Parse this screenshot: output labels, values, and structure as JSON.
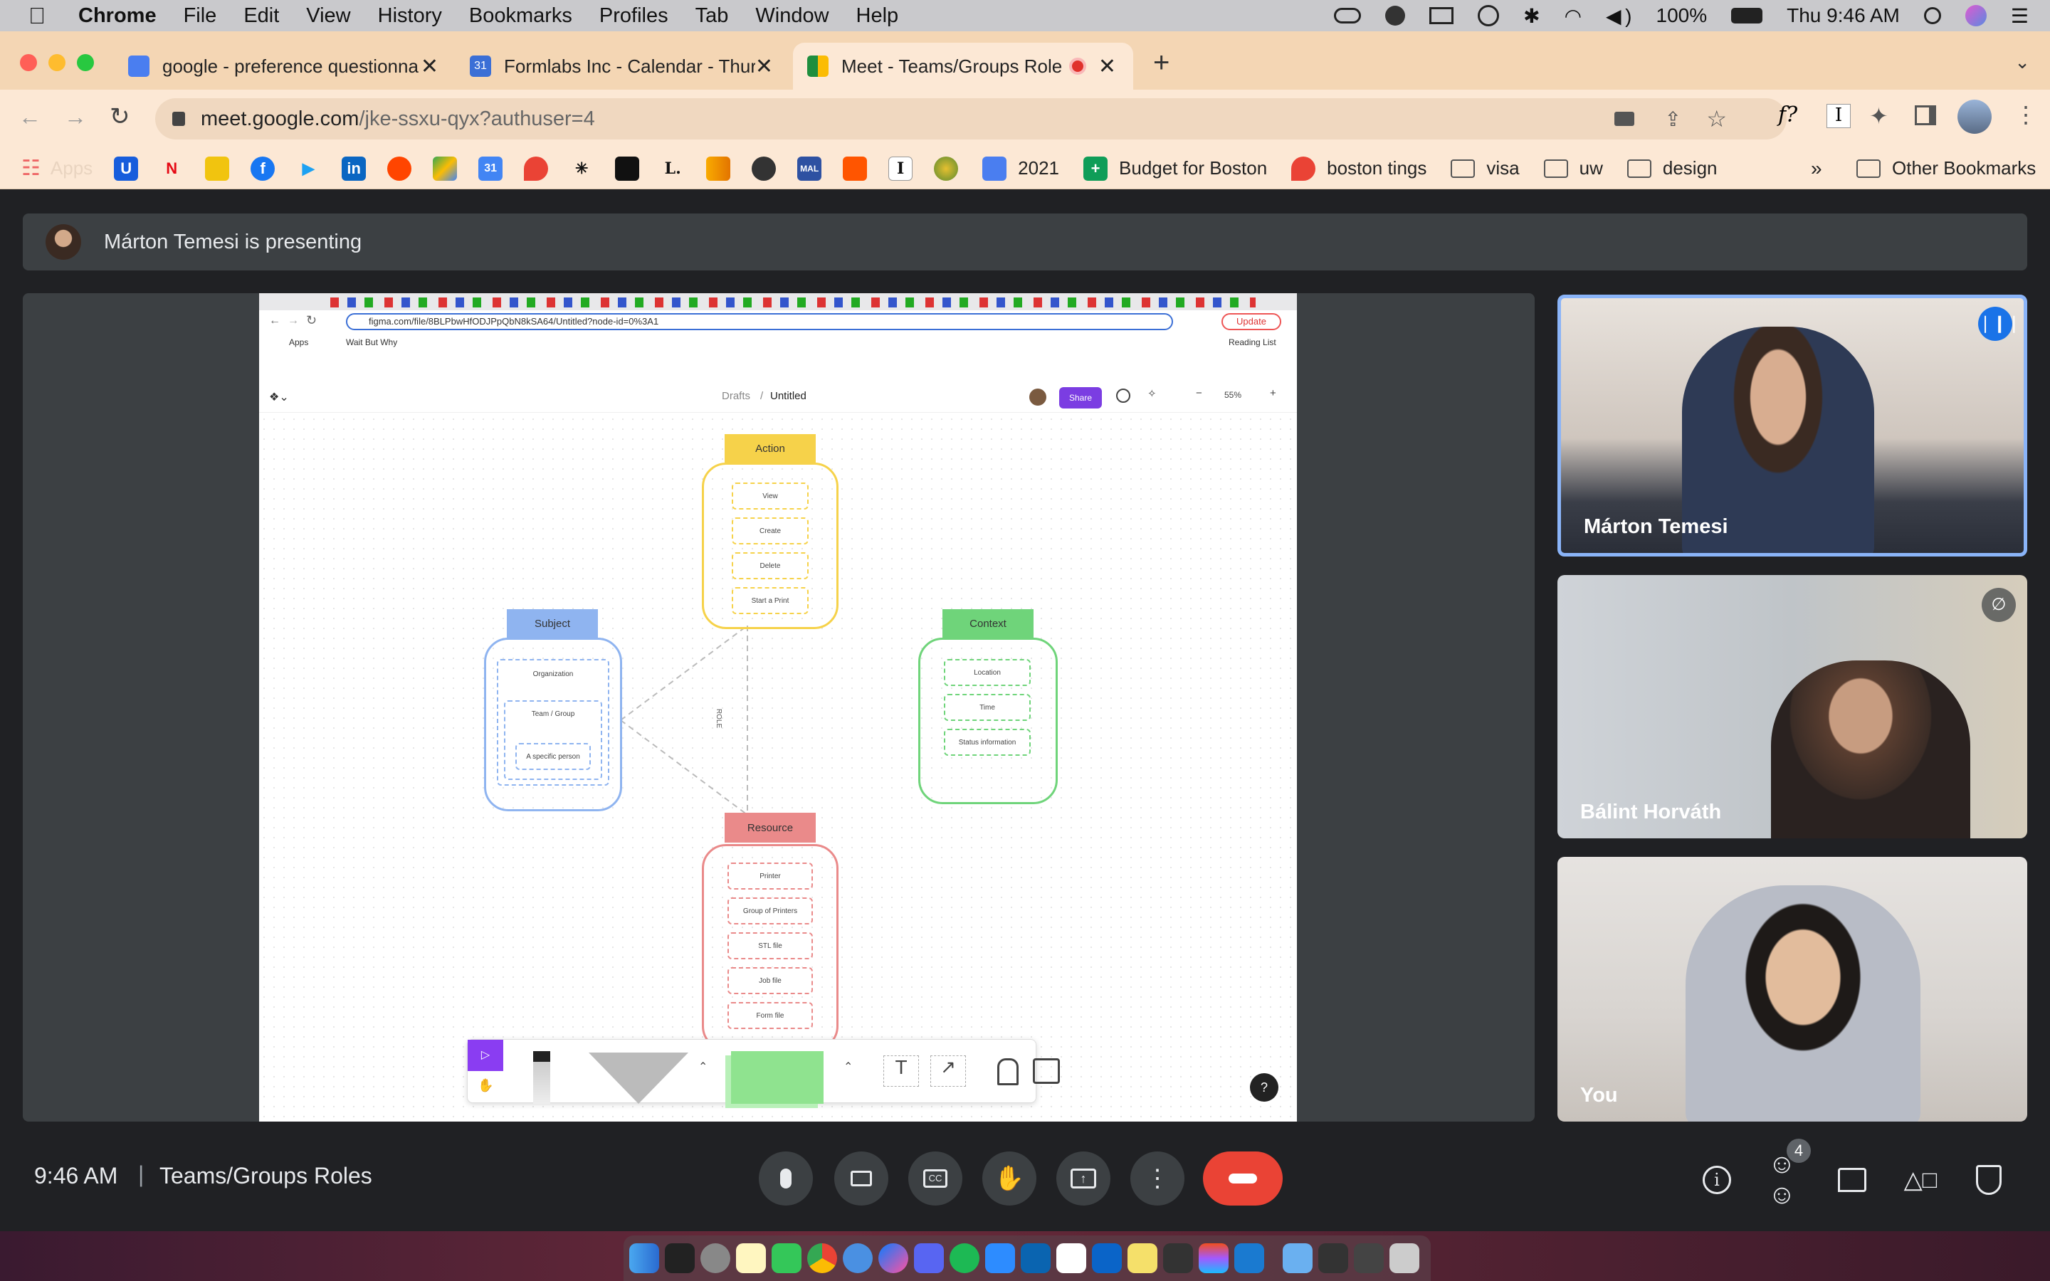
{
  "menubar": {
    "app": "Chrome",
    "items": [
      "File",
      "Edit",
      "View",
      "History",
      "Bookmarks",
      "Profiles",
      "Tab",
      "Window",
      "Help"
    ],
    "battery": "100%",
    "clock": "Thu 9:46 AM"
  },
  "tabs": [
    {
      "title": "google - preference questionna",
      "favicon_color": "#4a7ef0"
    },
    {
      "title": "Formlabs Inc - Calendar - Thur",
      "favicon_color": "#3b6fd6"
    },
    {
      "title": "Meet - Teams/Groups Role",
      "favicon_color": "#1e8e3e"
    }
  ],
  "address": {
    "host": "meet.google.com",
    "path": "/jke-ssxu-qyx?authuser=4"
  },
  "bookmarks": {
    "apps_label": "Apps",
    "named": [
      {
        "label": "2021",
        "kind": "doc"
      },
      {
        "label": "Budget for Boston",
        "kind": "sheet"
      },
      {
        "label": "boston tings",
        "kind": "map"
      },
      {
        "label": "visa",
        "kind": "folder"
      },
      {
        "label": "uw",
        "kind": "folder"
      },
      {
        "label": "design",
        "kind": "folder"
      }
    ],
    "more": "»",
    "other": "Other Bookmarks"
  },
  "presenting": {
    "text": "Márton Temesi is presenting"
  },
  "shared": {
    "url": "figma.com/file/8BLPbwHfODJPpQbN8kSA64/Untitled?node-id=0%3A1",
    "update_label": "Update",
    "apps_label": "Apps",
    "wbw_label": "Wait But Why",
    "reading_list": "Reading List",
    "breadcrumb_root": "Drafts",
    "separator": "/",
    "file_name": "Untitled",
    "share_label": "Share",
    "zoom": "55%",
    "role_label": "ROLE",
    "help": "?",
    "boxes": {
      "action": {
        "title": "Action",
        "items": [
          "View",
          "Create",
          "Delete",
          "Start a Print"
        ]
      },
      "subject": {
        "title": "Subject",
        "items": [
          "Organization",
          "Team / Group",
          "A specific person"
        ]
      },
      "context": {
        "title": "Context",
        "items": [
          "Location",
          "Time",
          "Status information"
        ]
      },
      "resource": {
        "title": "Resource",
        "items": [
          "Printer",
          "Group of Printers",
          "STL file",
          "Job file",
          "Form file"
        ]
      }
    }
  },
  "participants": [
    {
      "name": "Márton Temesi",
      "speaking": true
    },
    {
      "name": "Bálint Horváth",
      "muted": true
    },
    {
      "name": "You"
    }
  ],
  "meeting": {
    "time": "9:46 AM",
    "divider": "|",
    "title": "Teams/Groups Roles",
    "people_count": "4"
  },
  "colors": {
    "action": "#f6d24a",
    "subject": "#8fb4f0",
    "context": "#6fd47a",
    "resource": "#ea8a8a",
    "end_call": "#ea4335",
    "highlight": "#8ab4f8"
  }
}
